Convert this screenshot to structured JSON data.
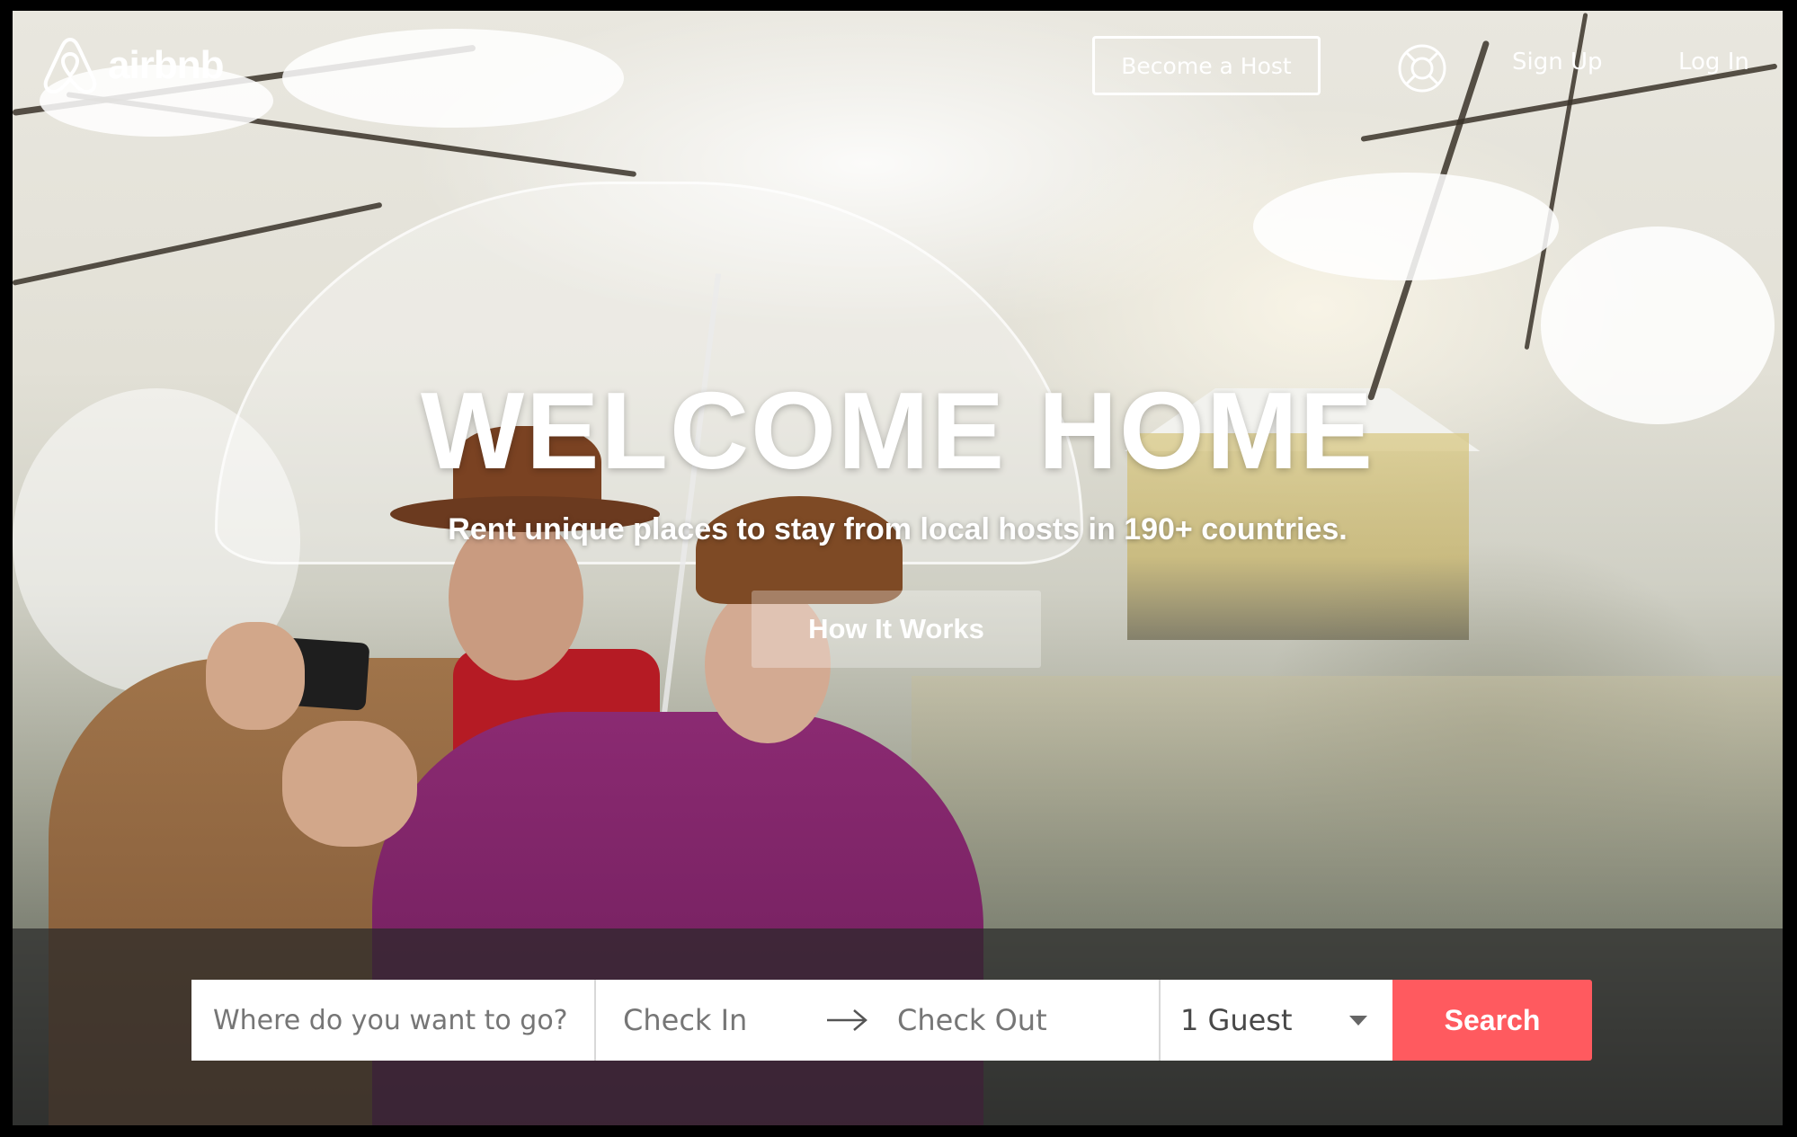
{
  "nav": {
    "brand": "airbnb",
    "become_host": "Become a Host",
    "sign_up": "Sign Up",
    "log_in": "Log In",
    "help_icon": "lifebuoy-icon"
  },
  "hero": {
    "title": "WELCOME HOME",
    "subtitle": "Rent unique places to stay from local hosts in 190+ countries.",
    "how_it_works": "How It Works"
  },
  "search": {
    "where_placeholder": "Where do you want to go?",
    "check_in": "Check In",
    "check_out": "Check Out",
    "guests": "1 Guest",
    "button": "Search",
    "arrow_icon": "arrow-right-icon",
    "dropdown_icon": "caret-down-icon"
  },
  "colors": {
    "brand_red": "#ff5a5f",
    "band": "#282828"
  }
}
